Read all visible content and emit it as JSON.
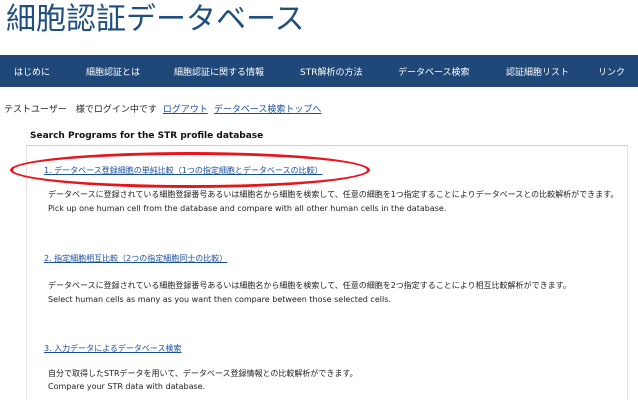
{
  "site": {
    "title": "細胞認証データベース"
  },
  "nav": {
    "items": [
      {
        "label": "はじめに"
      },
      {
        "label": "細胞認証とは"
      },
      {
        "label": "細胞認証に関する情報"
      },
      {
        "label": "STR解析の方法"
      },
      {
        "label": "データベース検索"
      },
      {
        "label": "認証細胞リスト"
      },
      {
        "label": "リンク"
      }
    ]
  },
  "status": {
    "login_text": "テストユーザー　様でログイン中です",
    "logout_label": "ログアウト",
    "top_link_label": "データベース検索トップへ"
  },
  "panel": {
    "title": "Search Programs for the STR profile database"
  },
  "programs": [
    {
      "link": "1. データベース登録細胞の単純比較（1つの指定細胞とデータベースの比較）",
      "desc_ja": "データベースに登録されている細胞登録番号あるいは細胞名から細胞を検索して、任意の細胞を1つ指定することによりデータベースとの比較解析ができます。",
      "desc_en": "Pick up one human cell from the database and compare with all other human cells in the database."
    },
    {
      "link": "2. 指定細胞相互比較（2つの指定細胞同士の比較）",
      "desc_ja": "データベースに登録されている細胞登録番号あるいは細胞名から細胞を検索して、任意の細胞を2つ指定することにより相互比較解析ができます。",
      "desc_en": "Select human cells as many as you want then compare between those selected cells."
    },
    {
      "link": "3. 入力データによるデータベース検索",
      "desc_ja": "自分で取得したSTRデータを用いて、データベース登録情報との比較解析ができます。",
      "desc_en": "Compare your STR data with database."
    }
  ],
  "annotation": {
    "color": "#e8141e"
  }
}
